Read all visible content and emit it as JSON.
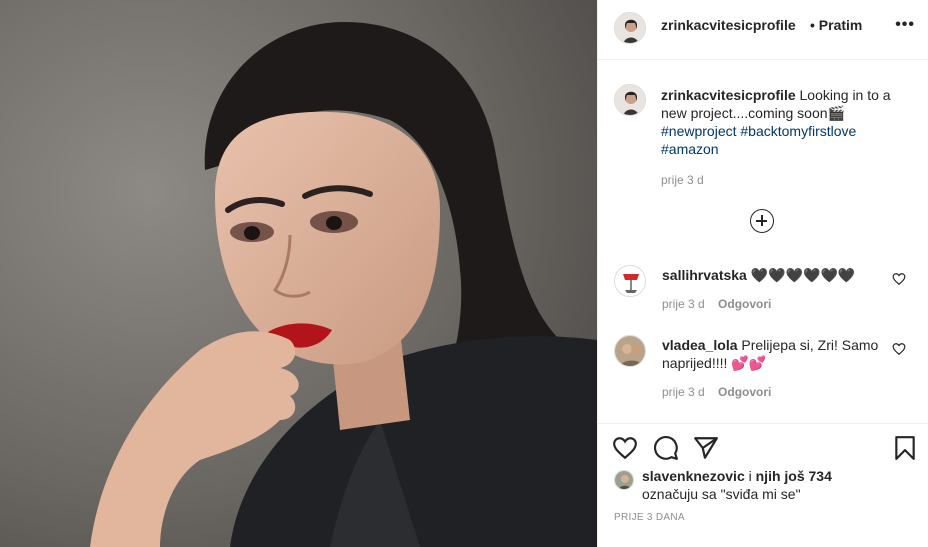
{
  "post": {
    "author": "zrinkacvitesicprofile",
    "follow_label": "• Pratim",
    "more_glyph": "•••"
  },
  "caption": {
    "username": "zrinkacvitesicprofile",
    "text": "Looking in to a new project....coming soon🎬",
    "hashtags": [
      "#newproject",
      "#backtomyfirstlove",
      "#amazon"
    ],
    "time": "prije 3 d"
  },
  "comments": [
    {
      "username": "sallihrvatska",
      "text": "🖤🖤🖤🖤🖤🖤",
      "time": "prije 3 d",
      "reply": "Odgovori"
    },
    {
      "username": "vladea_lola",
      "text": "Prelijepa si, Zri! Samo naprijed!!!! 💕💕",
      "time": "prije 3 d",
      "reply": "Odgovori"
    }
  ],
  "likes": {
    "user": "slavenknezovic",
    "joiner": " i ",
    "others": "njih još 734",
    "line2": "označuju sa \"sviđa mi se\""
  },
  "post_date": "PRIJE 3 DANA",
  "icons": {
    "header_avatar": "profile-avatar-icon",
    "add_comment": "plus-circle-icon",
    "like": "heart-icon",
    "comment": "speech-bubble-icon",
    "share": "paper-plane-icon",
    "save": "bookmark-icon"
  },
  "colors": {
    "text": "#262626",
    "muted": "#8e8e8e",
    "hashtag": "#00376b",
    "divider": "#efefef"
  }
}
